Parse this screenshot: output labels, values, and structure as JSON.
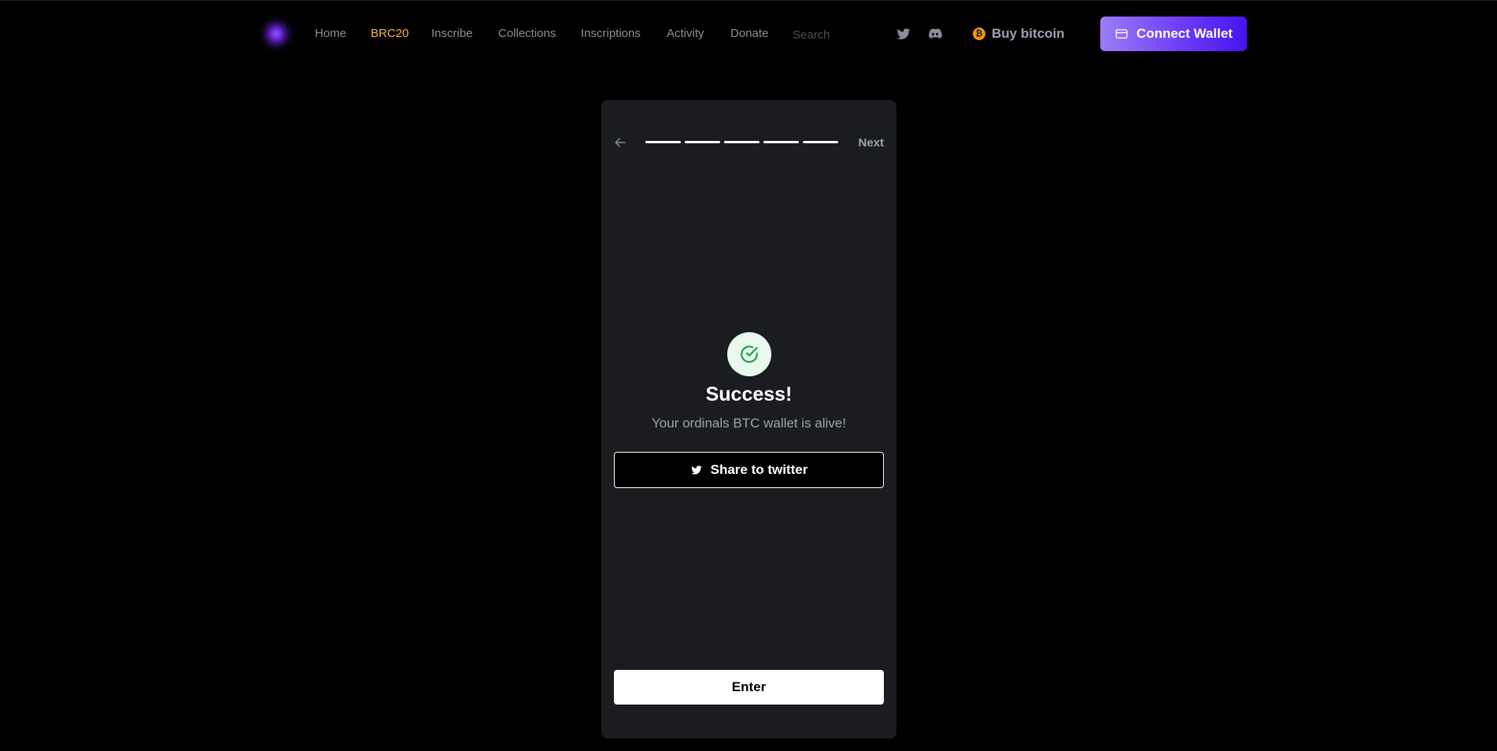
{
  "nav": {
    "items": [
      {
        "label": "Home",
        "active": false
      },
      {
        "label": "BRC20",
        "active": true
      },
      {
        "label": "Inscribe",
        "active": false
      },
      {
        "label": "Collections",
        "active": false
      },
      {
        "label": "Inscriptions",
        "active": false
      },
      {
        "label": "Activity",
        "active": false
      },
      {
        "label": "Donate",
        "active": false
      }
    ],
    "search_placeholder": "Search",
    "buy_bitcoin_label": "Buy bitcoin",
    "connect_wallet_label": "Connect Wallet"
  },
  "icons": {
    "logo": "logo-orb-icon",
    "twitter": "twitter-icon",
    "discord": "discord-icon",
    "bitcoin": "bitcoin-icon",
    "wallet": "wallet-icon",
    "back": "arrow-left-icon",
    "success": "check-circle-icon",
    "share": "twitter-icon"
  },
  "colors": {
    "background": "#000000",
    "card": "#1b1c20",
    "active_nav": "#f5b83d",
    "accent_start": "#9b7df7",
    "accent_end": "#4514f0",
    "success": "#16a34a",
    "bitcoin": "#f7931a"
  },
  "wizard": {
    "progress": {
      "completed_steps": 5,
      "total_steps": 5
    },
    "next_label": "Next",
    "title": "Success!",
    "subtitle": "Your ordinals BTC wallet is alive!",
    "share_label": "Share to twitter",
    "enter_label": "Enter"
  }
}
